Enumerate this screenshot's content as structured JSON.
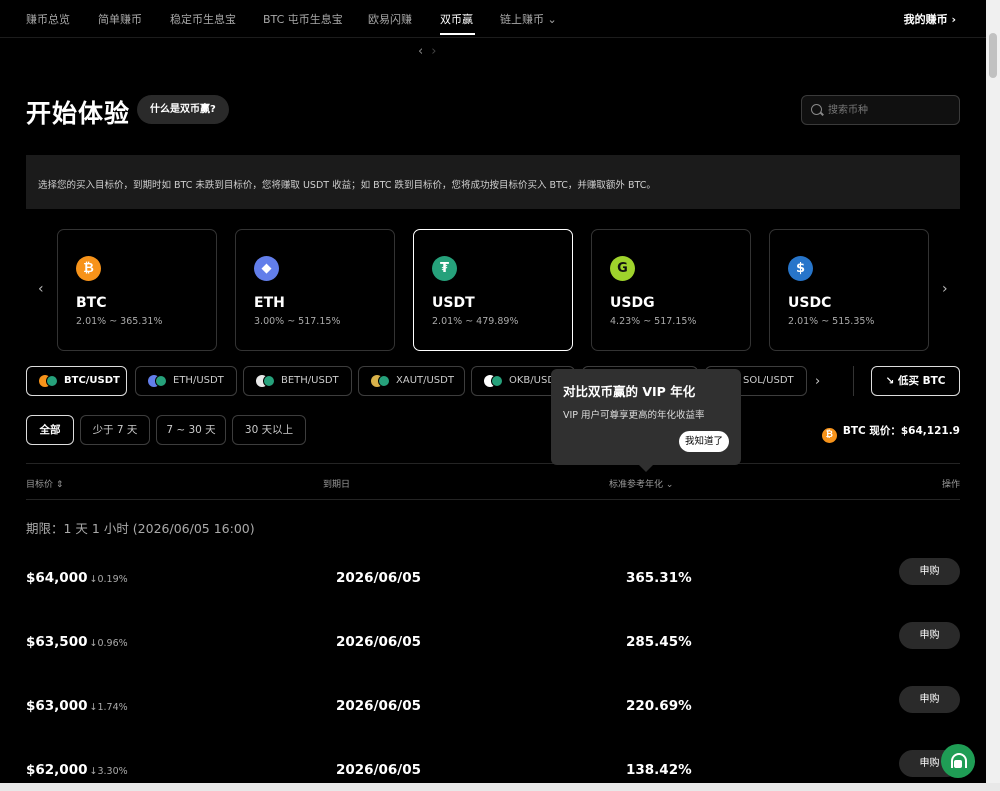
{
  "nav": {
    "items": [
      "赚币总览",
      "简单赚币",
      "稳定币生息宝",
      "BTC 屯币生息宝",
      "欧易闪赚",
      "双币赢",
      "链上赚币 ⌄"
    ],
    "active_index": 5,
    "my_earn": "我的赚币 ›"
  },
  "header": {
    "title": "开始体验",
    "what_is": "什么是双币赢?",
    "search_placeholder": "搜索币种"
  },
  "banner": "选择您的买入目标价，到期时如 BTC 未跌到目标价，您将赚取 USDT 收益；如 BTC 跌到目标价，您将成功按目标价买入 BTC，并赚取额外 BTC。",
  "coins": [
    {
      "name": "BTC",
      "range": "2.01% ~ 365.31%",
      "color": "#f7931a",
      "glyph": "₿"
    },
    {
      "name": "ETH",
      "range": "3.00% ~ 517.15%",
      "color": "#627eea",
      "glyph": "◆"
    },
    {
      "name": "USDT",
      "range": "2.01% ~ 479.89%",
      "color": "#26a17b",
      "glyph": "₮"
    },
    {
      "name": "USDG",
      "range": "4.23% ~ 517.15%",
      "color": "#9fd32c",
      "glyph": "G"
    },
    {
      "name": "USDC",
      "range": "2.01% ~ 515.35%",
      "color": "#2775ca",
      "glyph": "$"
    }
  ],
  "pairs": [
    "BTC/USDT",
    "ETH/USDT",
    "BETH/USDT",
    "XAUT/USDT",
    "OKB/USDT",
    "",
    "SOL/USDT"
  ],
  "low_buy": "↘  低买 BTC",
  "periods": [
    "全部",
    "少于 7 天",
    "7 ~ 30 天",
    "30 天以上"
  ],
  "btc_price": "BTC 现价：$64,121.9",
  "tooltip": {
    "title": "对比双币赢的 VIP 年化",
    "body": "VIP 用户可尊享更高的年化收益率",
    "button": "我知道了"
  },
  "table": {
    "headers": {
      "target": "目标价 ⇕",
      "expiry": "到期日",
      "apy": "标准参考年化 ⌄",
      "action": "操作"
    },
    "term": "期限：1 天 1 小时 (2026/06/05 16:00)",
    "rows": [
      {
        "price": "$64,000",
        "diff": "↓0.19%",
        "date": "2026/06/05",
        "apy": "365.31%",
        "action": "申购"
      },
      {
        "price": "$63,500",
        "diff": "↓0.96%",
        "date": "2026/06/05",
        "apy": "285.45%",
        "action": "申购"
      },
      {
        "price": "$63,000",
        "diff": "↓1.74%",
        "date": "2026/06/05",
        "apy": "220.69%",
        "action": "申购"
      },
      {
        "price": "$62,000",
        "diff": "↓3.30%",
        "date": "2026/06/05",
        "apy": "138.42%",
        "action": "申购"
      }
    ]
  }
}
